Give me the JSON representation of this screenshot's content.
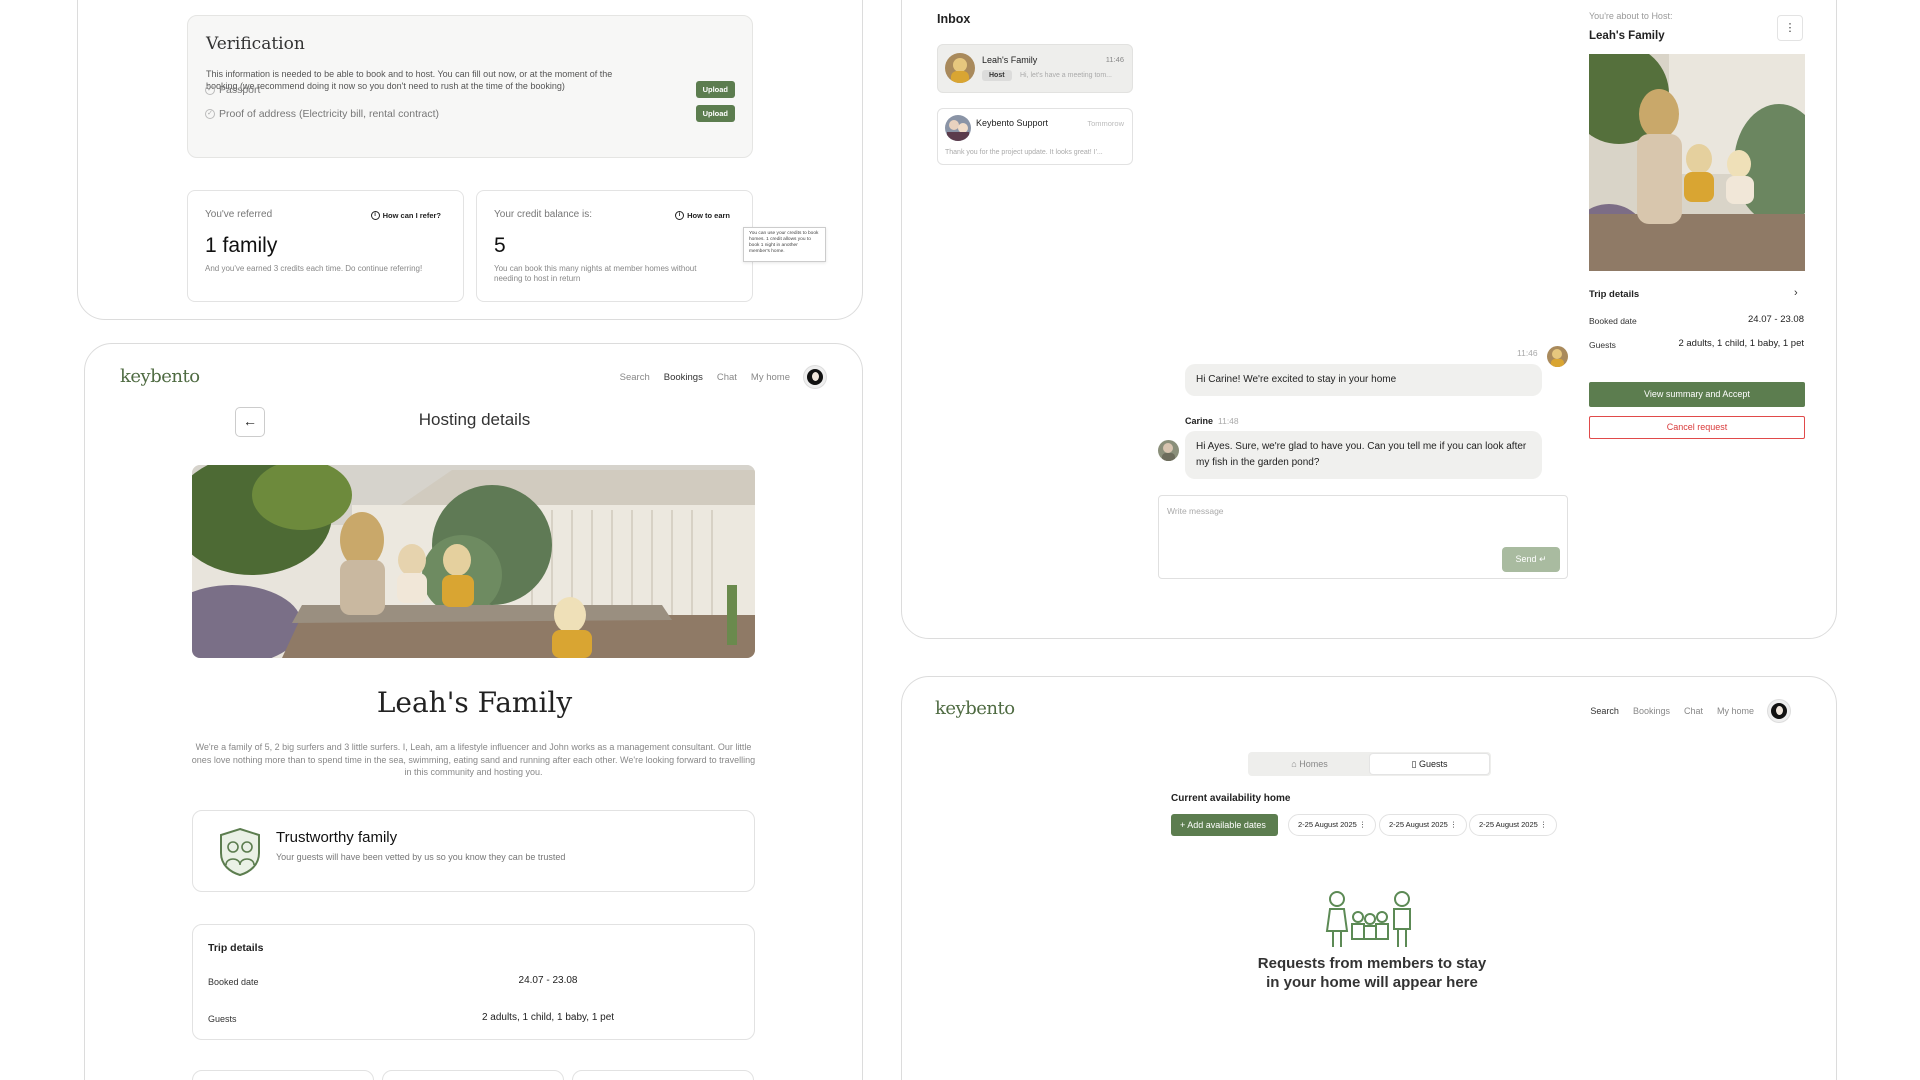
{
  "colors": {
    "brand_green": "#5c7d4f",
    "danger_red": "#d93b3b",
    "muted_green": "#a9bba0"
  },
  "profile": {
    "verification": {
      "title": "Verification",
      "description": "This information is needed to be able to book and to host. You can fill out now, or at the moment of the booking (we recommend doing it now so you don't need to rush at the time of the booking)",
      "items": [
        {
          "label": "Passport",
          "button": "Upload"
        },
        {
          "label": "Proof of address (Electricity bill, rental contract)",
          "button": "Upload"
        }
      ]
    },
    "referred": {
      "label": "You've referred",
      "link": "How can I refer?",
      "value": "1 family",
      "sub": "And you've earned 3 credits each time. Do continue referring!"
    },
    "credits": {
      "label": "Your credit balance is:",
      "link": "How to earn",
      "value": "5",
      "sub": "You can book this many nights at member homes without needing to host in return"
    },
    "tooltip": "You can use your credits to book homes. 1 credit allows you to book 1 night in another member's home."
  },
  "hosting": {
    "logo": "keybento",
    "nav": [
      "Search",
      "Bookings",
      "Chat",
      "My home"
    ],
    "active_nav": "Bookings",
    "title": "Hosting details",
    "family_name": "Leah's Family",
    "description": "We're a family of 5, 2 big surfers and 3 little surfers. I, Leah, am a lifestyle influencer and John works as a management consultant. Our little ones love nothing more than to spend time in the sea, swimming, eating sand and running after each other. We're looking forward to travelling in this community and hosting you.",
    "trust": {
      "title": "Trustworthy family",
      "subtitle": "Your guests will have been vetted by us so you know they can be trusted",
      "icon": "shield-family-icon"
    },
    "trip": {
      "title": "Trip details",
      "rows": [
        {
          "label": "Booked date",
          "value": "24.07 - 23.08"
        },
        {
          "label": "Guests",
          "value": "2 adults, 1 child, 1 baby, 1 pet"
        }
      ]
    }
  },
  "inbox": {
    "title": "Inbox",
    "conversations": [
      {
        "name": "Leah's Family",
        "time": "11:46",
        "badge": "Host",
        "preview": "Hi, let's have a meeting tom..."
      },
      {
        "name": "Keybento Support",
        "time": "Tommorow",
        "preview": "Thank you for the project update. It looks great! I'..."
      }
    ],
    "messages": [
      {
        "time": "11:46",
        "text": "Hi Carine! We're excited to stay in your home"
      },
      {
        "sender": "Carine",
        "time": "11:48",
        "text": "Hi Ayes. Sure, we're glad to have you. Can you tell me if you can look after my fish in the garden pond?"
      }
    ],
    "composer": {
      "placeholder": "Write message",
      "send": "Send"
    },
    "side": {
      "about_label": "You're about to Host:",
      "about_name": "Leah's Family",
      "more": "⋮",
      "trip_title": "Trip details",
      "rows": [
        {
          "label": "Booked date",
          "value": "24.07 - 23.08"
        },
        {
          "label": "Guests",
          "value": "2 adults, 1 child, 1 baby, 1 pet"
        }
      ],
      "accept": "View summary and Accept",
      "cancel": "Cancel request"
    }
  },
  "availability": {
    "logo": "keybento",
    "nav": [
      "Search",
      "Bookings",
      "Chat",
      "My home"
    ],
    "active_nav": "Search",
    "tabs": [
      "Homes",
      "Guests"
    ],
    "active_tab": "Guests",
    "title": "Current availability home",
    "add_button": "Add available dates",
    "dates": [
      "2-25 August 2025",
      "2-25 August 2025",
      "2-25 August 2025"
    ],
    "empty_text": "Requests from members to stay in your home will appear here"
  }
}
